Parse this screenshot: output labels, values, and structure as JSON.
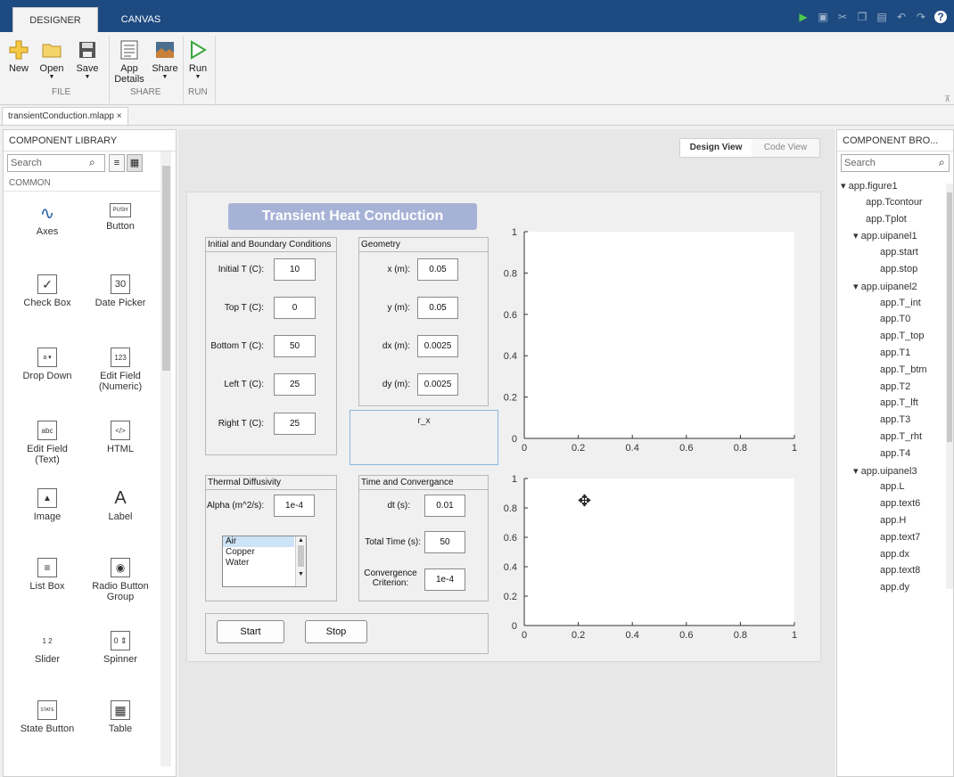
{
  "top_tabs": [
    "DESIGNER",
    "CANVAS"
  ],
  "ribbon": {
    "buttons": {
      "new": "New",
      "open": "Open",
      "save": "Save",
      "app_details_1": "App",
      "app_details_2": "Details",
      "share": "Share",
      "run": "Run"
    },
    "groups": {
      "file": "FILE",
      "share": "SHARE",
      "run": "RUN"
    }
  },
  "file_tab": "transientConduction.mlapp ×",
  "library": {
    "title": "COMPONENT LIBRARY",
    "search_placeholder": "Search",
    "section": "COMMON",
    "components": [
      {
        "label": "Axes",
        "glyph": "∿"
      },
      {
        "label": "Button",
        "glyph": "PUSH"
      },
      {
        "label": "Check Box",
        "glyph": "✓"
      },
      {
        "label": "Date Picker",
        "glyph": "30"
      },
      {
        "label": "Drop Down",
        "glyph": "a ▾"
      },
      {
        "label": "Edit Field (Numeric)",
        "glyph": "123"
      },
      {
        "label": "Edit Field (Text)",
        "glyph": "abc"
      },
      {
        "label": "HTML",
        "glyph": "</>"
      },
      {
        "label": "Image",
        "glyph": "▲"
      },
      {
        "label": "Label",
        "glyph": "A"
      },
      {
        "label": "List Box",
        "glyph": "≡"
      },
      {
        "label": "Radio Button Group",
        "glyph": "◉"
      },
      {
        "label": "Slider",
        "glyph": "1 2"
      },
      {
        "label": "Spinner",
        "glyph": "0 ⇕"
      },
      {
        "label": "State Button",
        "glyph": "STATE"
      },
      {
        "label": "Table",
        "glyph": "▦"
      }
    ]
  },
  "view_toggle": {
    "design": "Design View",
    "code": "Code View"
  },
  "app": {
    "title": "Transient Heat Conduction",
    "bc_panel": {
      "title": "Initial and Boundary Conditions",
      "fields": [
        {
          "label": "Initial T (C):",
          "value": "10"
        },
        {
          "label": "Top T (C):",
          "value": "0"
        },
        {
          "label": "Bottom T (C):",
          "value": "50"
        },
        {
          "label": "Left T (C):",
          "value": "25"
        },
        {
          "label": "Right T (C):",
          "value": "25"
        }
      ]
    },
    "geometry_panel": {
      "title": "Geometry",
      "fields": [
        {
          "label": "x (m):",
          "value": "0.05"
        },
        {
          "label": "y (m):",
          "value": "0.05"
        },
        {
          "label": "dx (m):",
          "value": "0.0025"
        },
        {
          "label": "dy (m):",
          "value": "0.0025"
        }
      ]
    },
    "rx_label": "r_x",
    "diffusivity_panel": {
      "title": "Thermal Diffusivity",
      "alpha_label": "Alpha (m^2/s):",
      "alpha_value": "1e-4",
      "materials": [
        "Air",
        "Copper",
        "Water"
      ],
      "selected": "Air"
    },
    "time_panel": {
      "title": "Time and Convergance",
      "dt_label": "dt (s):",
      "dt_value": "0.01",
      "total_label": "Total Time (s):",
      "total_value": "50",
      "conv_label_1": "Convergence",
      "conv_label_2": "Criterion:",
      "conv_value": "1e-4"
    },
    "start_label": "Start",
    "stop_label": "Stop"
  },
  "chart_data": [
    {
      "type": "line",
      "series": [],
      "xlim": [
        0,
        1
      ],
      "ylim": [
        0,
        1
      ],
      "xticks": [
        "0",
        "0.2",
        "0.4",
        "0.6",
        "0.8",
        "1"
      ],
      "yticks": [
        "0",
        "0.2",
        "0.4",
        "0.6",
        "0.8",
        "1"
      ]
    },
    {
      "type": "line",
      "series": [],
      "xlim": [
        0,
        1
      ],
      "ylim": [
        0,
        1
      ],
      "xticks": [
        "0",
        "0.2",
        "0.4",
        "0.6",
        "0.8",
        "1"
      ],
      "yticks": [
        "0",
        "0.2",
        "0.4",
        "0.6",
        "0.8",
        "1"
      ]
    }
  ],
  "browser": {
    "title": "COMPONENT BRO...",
    "search_placeholder": "Search",
    "tree": [
      {
        "label": "app.figure1",
        "level": 0,
        "expandable": true
      },
      {
        "label": "app.Tcontour",
        "level": 1,
        "expandable": false
      },
      {
        "label": "app.Tplot",
        "level": 1,
        "expandable": false
      },
      {
        "label": "app.uipanel1",
        "level": 1,
        "expandable": true
      },
      {
        "label": "app.start",
        "level": 2,
        "expandable": false
      },
      {
        "label": "app.stop",
        "level": 2,
        "expandable": false
      },
      {
        "label": "app.uipanel2",
        "level": 1,
        "expandable": true
      },
      {
        "label": "app.T_int",
        "level": 2,
        "expandable": false
      },
      {
        "label": "app.T0",
        "level": 2,
        "expandable": false
      },
      {
        "label": "app.T_top",
        "level": 2,
        "expandable": false
      },
      {
        "label": "app.T1",
        "level": 2,
        "expandable": false
      },
      {
        "label": "app.T_btm",
        "level": 2,
        "expandable": false
      },
      {
        "label": "app.T2",
        "level": 2,
        "expandable": false
      },
      {
        "label": "app.T_lft",
        "level": 2,
        "expandable": false
      },
      {
        "label": "app.T3",
        "level": 2,
        "expandable": false
      },
      {
        "label": "app.T_rht",
        "level": 2,
        "expandable": false
      },
      {
        "label": "app.T4",
        "level": 2,
        "expandable": false
      },
      {
        "label": "app.uipanel3",
        "level": 1,
        "expandable": true
      },
      {
        "label": "app.L",
        "level": 2,
        "expandable": false
      },
      {
        "label": "app.text6",
        "level": 2,
        "expandable": false
      },
      {
        "label": "app.H",
        "level": 2,
        "expandable": false
      },
      {
        "label": "app.text7",
        "level": 2,
        "expandable": false
      },
      {
        "label": "app.dx",
        "level": 2,
        "expandable": false
      },
      {
        "label": "app.text8",
        "level": 2,
        "expandable": false
      },
      {
        "label": "app.dy",
        "level": 2,
        "expandable": false
      }
    ]
  },
  "colors": {
    "topbar": "#1d4a80",
    "title_bg": "#a7b3d6",
    "run_green": "#3aa53a",
    "selection": "#cde3f7"
  }
}
